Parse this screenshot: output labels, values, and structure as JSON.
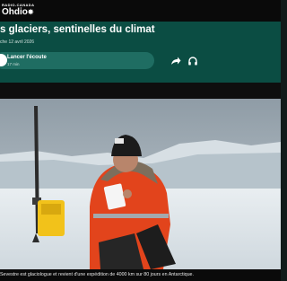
{
  "brand": {
    "small": "RADIO-CANADA",
    "main": "Ohdio",
    "mark": "✸"
  },
  "article": {
    "title": "s glaciers, sentinelles du climat",
    "date": "che 12 avril 2026"
  },
  "player": {
    "label": "Lancer l'écoute",
    "duration": "17 min"
  },
  "photo": {
    "caption": "Sevestre est glaciologue et revient d'une expédition de 4000 km sur 80 jours en Antarctique."
  },
  "colors": {
    "header": "#0b4d43",
    "button": "#1f6d62",
    "accent_jacket": "#e2441c",
    "case": "#f2c21a"
  }
}
